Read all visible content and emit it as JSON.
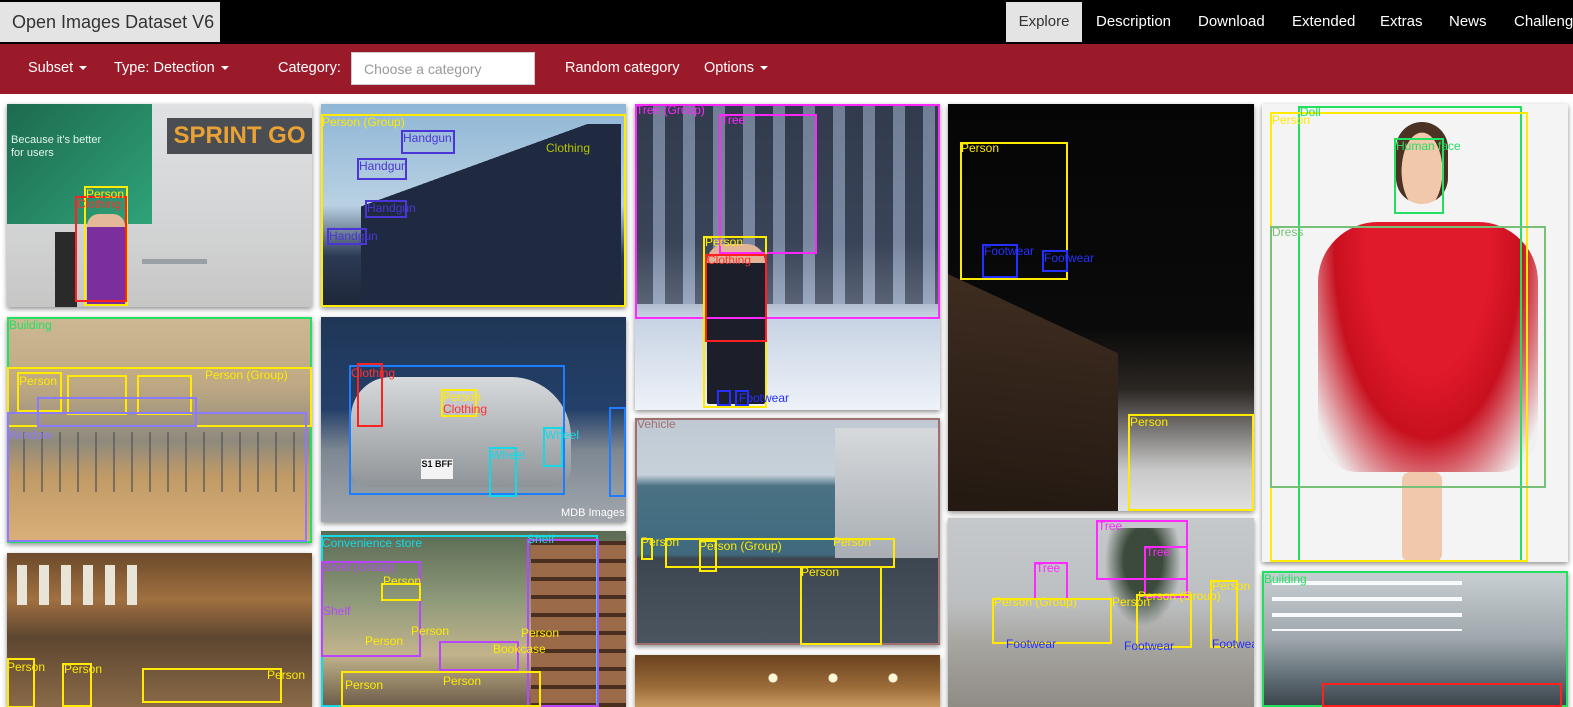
{
  "brand": "Open Images Dataset V6",
  "nav": [
    {
      "label": "Explore",
      "active": true
    },
    {
      "label": "Description"
    },
    {
      "label": "Download"
    },
    {
      "label": "Extended"
    },
    {
      "label": "Extras"
    },
    {
      "label": "News"
    },
    {
      "label": "Challeng"
    }
  ],
  "toolbar": {
    "subset_label": "Subset",
    "type_label": "Type: Detection",
    "category_label": "Category:",
    "category_placeholder": "Choose a category",
    "random_label": "Random category",
    "options_label": "Options"
  },
  "colors": {
    "toolbar_bg": "#9b1a2a",
    "topbar_bg": "#000000",
    "brand_bg": "#e4e4e4"
  },
  "tiles": [
    {
      "scene_text": "SPRINT GO",
      "screen_text": "Because it's better for users",
      "labels": [
        "Person",
        "Clothing"
      ]
    },
    {
      "labels": [
        "Person (Group)",
        "Handgun",
        "Handgun",
        "Handgun",
        "Handgun",
        "Clothing"
      ]
    },
    {
      "labels": [
        "Tree (Group)",
        "Tree",
        "Person",
        "Clothing",
        "Footwear"
      ]
    },
    {
      "labels": [
        "Person",
        "Footwear",
        "Footwear",
        "Person"
      ]
    },
    {
      "labels": [
        "Doll",
        "Person",
        "Human face",
        "Dress"
      ]
    },
    {
      "labels": [
        "Building",
        "Person (Group)",
        "Person",
        "Window"
      ]
    },
    {
      "watermark": "MDB Images",
      "plate": "S1 BFF",
      "labels": [
        "Clothing",
        "Person",
        "Clothing",
        "Wheel",
        "Wheel",
        "Car"
      ]
    },
    {
      "labels": [
        "Person (Group)",
        "Person",
        "Person",
        "Person",
        "Vehicle"
      ]
    },
    {
      "labels": [
        "Tree",
        "Tree",
        "Tree",
        "Person (Group)",
        "Person",
        "Person (Group)",
        "Person",
        "Footwear",
        "Footwear",
        "Footwear"
      ]
    },
    {
      "labels": [
        "Person",
        "Person",
        "Person"
      ]
    },
    {
      "labels": [
        "Convenience store",
        "Shelf",
        "Shelf (Group)",
        "Person",
        "Shelf",
        "Person",
        "Person",
        "Person",
        "Person",
        "Person",
        "Bookcase"
      ]
    },
    {
      "labels": [
        "Building"
      ]
    }
  ]
}
